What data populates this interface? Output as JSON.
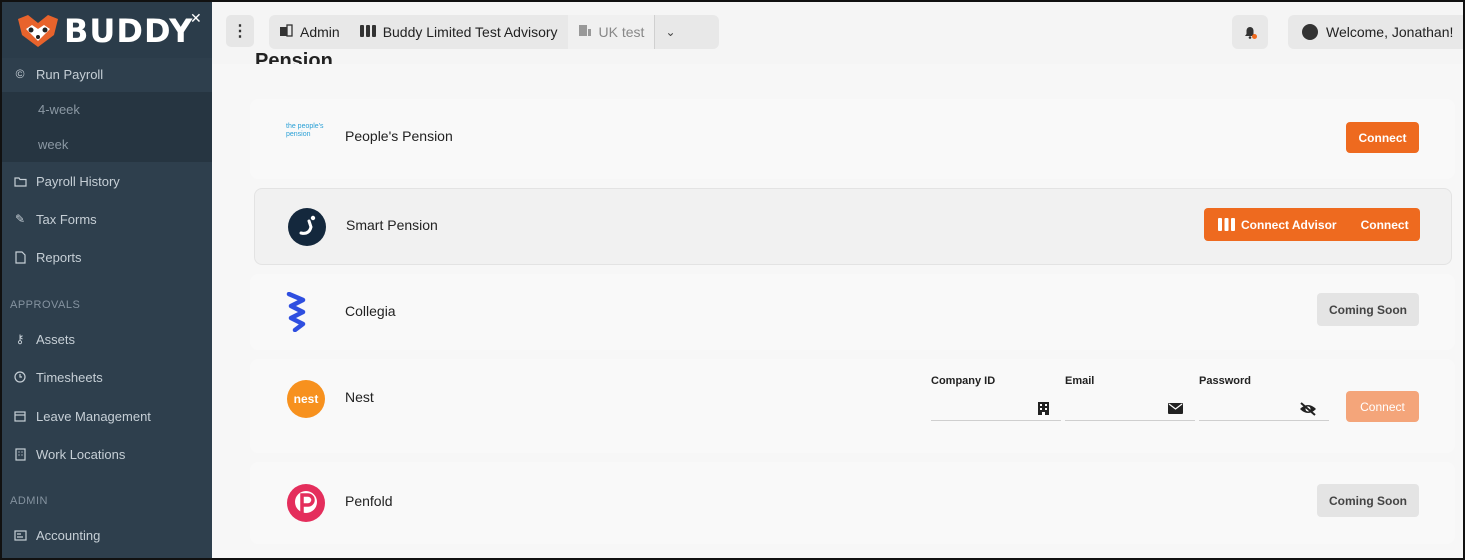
{
  "app": {
    "logo_text": "BUDDY",
    "brand_color": "#ee6a1f"
  },
  "sidebar": {
    "items": [
      {
        "label": "Run Payroll",
        "icon": "copyright-circle-icon"
      },
      {
        "label": "Payroll History",
        "icon": "folder-icon"
      },
      {
        "label": "Tax Forms",
        "icon": "edit-icon"
      },
      {
        "label": "Reports",
        "icon": "file-icon"
      }
    ],
    "sub_items": [
      "4-week",
      "week"
    ],
    "approvals_header": "APPROVALS",
    "approvals": [
      {
        "label": "Assets",
        "icon": "key-icon"
      },
      {
        "label": "Timesheets",
        "icon": "clock-icon"
      },
      {
        "label": "Leave Management",
        "icon": "calendar-icon"
      },
      {
        "label": "Work Locations",
        "icon": "building-icon"
      }
    ],
    "admin_header": "ADMIN",
    "admin": [
      {
        "label": "Accounting",
        "icon": "ledger-icon"
      }
    ]
  },
  "topbar": {
    "crumbs": [
      "Admin",
      "Buddy Limited Test Advisory",
      "UK test"
    ],
    "welcome": "Welcome, Jonathan!"
  },
  "main": {
    "section_title": "Pension",
    "providers": [
      {
        "name": "People's Pension",
        "logo_text": "the people's pension",
        "actions": [
          "Connect"
        ]
      },
      {
        "name": "Smart Pension",
        "actions": [
          "Connect Advisor",
          "Connect"
        ]
      },
      {
        "name": "Collegia",
        "actions": [
          "Coming Soon"
        ]
      },
      {
        "name": "Nest",
        "logo_text": "nest",
        "actions": [
          "Connect"
        ],
        "fields": [
          {
            "label": "Company ID",
            "value": "",
            "icon": "building-icon"
          },
          {
            "label": "Email",
            "value": "",
            "icon": "envelope-icon"
          },
          {
            "label": "Password",
            "value": "",
            "icon": "eye-slash-icon"
          }
        ]
      },
      {
        "name": "Penfold",
        "actions": [
          "Coming Soon"
        ]
      }
    ]
  }
}
